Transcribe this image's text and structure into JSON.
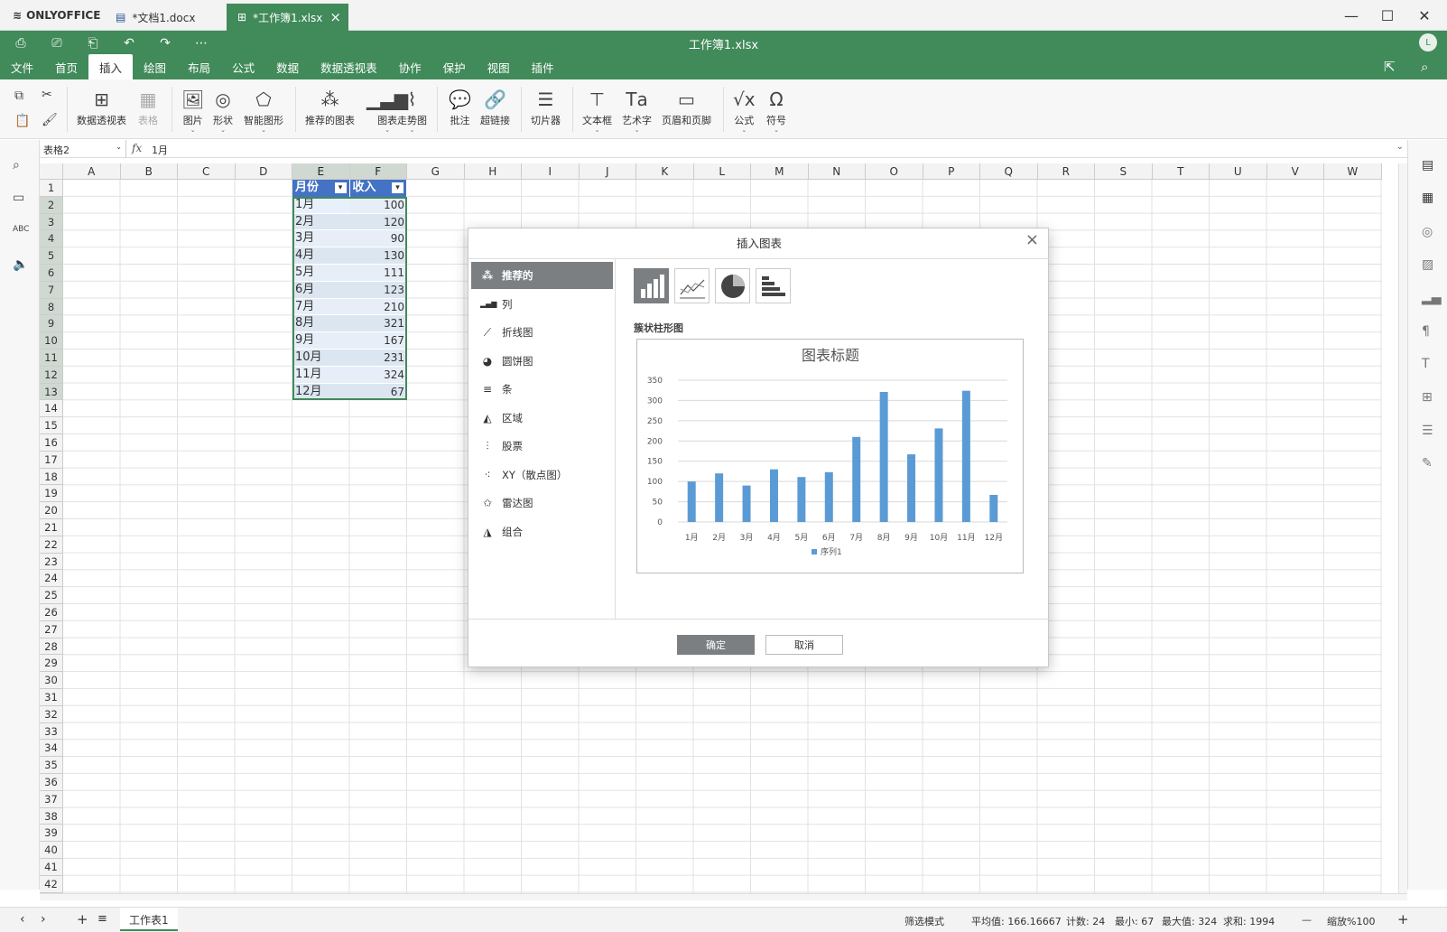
{
  "app": {
    "brand": "ONLYOFFICE",
    "doc_title": "工作簿1.xlsx",
    "user_initial": "L",
    "tabs": [
      {
        "label": "*文档1.docx",
        "active": false
      },
      {
        "label": "*工作簿1.xlsx",
        "active": true
      }
    ]
  },
  "colors": {
    "accent": "#418a5a",
    "dialog_active": "#7b7f82",
    "bar": "#5b9bd5",
    "table_header": "#4472c4",
    "table_band": "#dce6f1"
  },
  "menu": [
    "文件",
    "首页",
    "插入",
    "绘图",
    "布局",
    "公式",
    "数据",
    "数据透视表",
    "协作",
    "保护",
    "视图",
    "插件"
  ],
  "menu_active": "插入",
  "toolbar": {
    "pivot": "数据透视表",
    "table": "表格",
    "image": "图片",
    "shape": "形状",
    "smartart": "智能图形",
    "recommended": "推荐的图表",
    "chart": "图表",
    "sparkline": "走势图",
    "comment": "批注",
    "hyperlink": "超链接",
    "slicer": "切片器",
    "textbox": "文本框",
    "textart": "艺术字",
    "header_footer": "页眉和页脚",
    "equation": "公式",
    "symbol": "符号"
  },
  "formula": {
    "name_box": "表格2",
    "fx": "fx",
    "value": "1月"
  },
  "columns": [
    "A",
    "B",
    "C",
    "D",
    "E",
    "F",
    "G",
    "H",
    "I",
    "J",
    "K",
    "L",
    "M",
    "N",
    "O",
    "P",
    "Q",
    "R",
    "S",
    "T",
    "U",
    "V",
    "W"
  ],
  "rows": [
    1,
    2,
    3,
    4,
    5,
    6,
    7,
    8,
    9,
    10,
    11,
    12,
    13,
    14,
    15,
    16,
    17,
    18,
    19,
    20,
    21,
    22,
    23,
    24,
    25,
    26,
    27,
    28,
    29,
    30,
    31,
    32,
    33,
    34,
    35,
    36,
    37,
    38,
    39,
    40,
    41,
    42
  ],
  "table": {
    "headers": [
      "月份",
      "收入"
    ],
    "data": [
      [
        "1月",
        "100"
      ],
      [
        "2月",
        "120"
      ],
      [
        "3月",
        "90"
      ],
      [
        "4月",
        "130"
      ],
      [
        "5月",
        "111"
      ],
      [
        "6月",
        "123"
      ],
      [
        "7月",
        "210"
      ],
      [
        "8月",
        "321"
      ],
      [
        "9月",
        "167"
      ],
      [
        "10月",
        "231"
      ],
      [
        "11月",
        "324"
      ],
      [
        "12月",
        "67"
      ]
    ]
  },
  "dialog": {
    "title": "插入图表",
    "chart_types": [
      {
        "label": "推荐的",
        "icon": "recommended-icon",
        "active": true
      },
      {
        "label": "列",
        "icon": "column-chart-icon",
        "active": false
      },
      {
        "label": "折线图",
        "icon": "line-chart-icon",
        "active": false
      },
      {
        "label": "圆饼图",
        "icon": "pie-chart-icon",
        "active": false
      },
      {
        "label": "条",
        "icon": "bar-chart-icon",
        "active": false
      },
      {
        "label": "区域",
        "icon": "area-chart-icon",
        "active": false
      },
      {
        "label": "股票",
        "icon": "stock-chart-icon",
        "active": false
      },
      {
        "label": "XY（散点图）",
        "icon": "scatter-chart-icon",
        "active": false
      },
      {
        "label": "雷达图",
        "icon": "radar-chart-icon",
        "active": false
      },
      {
        "label": "组合",
        "icon": "combo-chart-icon",
        "active": false
      }
    ],
    "preview_label": "簇状柱形图",
    "ok": "确定",
    "cancel": "取消"
  },
  "chart_data": {
    "type": "bar",
    "title": "图表标题",
    "categories": [
      "1月",
      "2月",
      "3月",
      "4月",
      "5月",
      "6月",
      "7月",
      "8月",
      "9月",
      "10月",
      "11月",
      "12月"
    ],
    "series": [
      {
        "name": "序列1",
        "values": [
          100,
          120,
          90,
          130,
          111,
          123,
          210,
          321,
          167,
          231,
          324,
          67
        ]
      }
    ],
    "ylim": [
      0,
      350
    ],
    "yticks": [
      0,
      50,
      100,
      150,
      200,
      250,
      300,
      350
    ],
    "grid": true,
    "legend": "bottom"
  },
  "sheet": {
    "name": "工作表1"
  },
  "status": {
    "filter_mode": "筛选模式",
    "average": "平均值: 166.16667",
    "count": "计数: 24",
    "min": "最小: 67",
    "max": "最大值: 324",
    "sum": "求和: 1994",
    "zoom": "缩放%100"
  }
}
